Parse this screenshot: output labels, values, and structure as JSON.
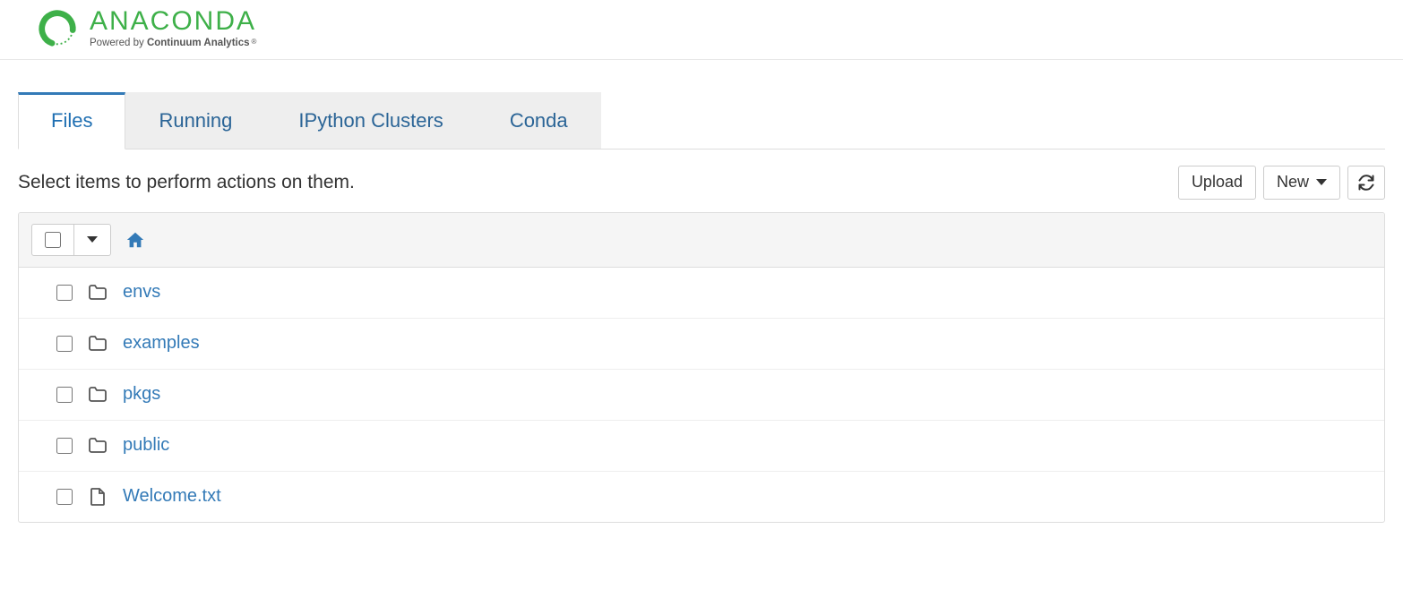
{
  "brand": {
    "name": "ANACONDA",
    "tagline_prefix": "Powered by ",
    "tagline_bold": "Continuum Analytics"
  },
  "tabs": [
    {
      "label": "Files",
      "active": true
    },
    {
      "label": "Running",
      "active": false
    },
    {
      "label": "IPython Clusters",
      "active": false
    },
    {
      "label": "Conda",
      "active": false
    }
  ],
  "instructions": "Select items to perform actions on them.",
  "buttons": {
    "upload": "Upload",
    "new": "New"
  },
  "items": [
    {
      "kind": "folder",
      "name": "envs"
    },
    {
      "kind": "folder",
      "name": "examples"
    },
    {
      "kind": "folder",
      "name": "pkgs"
    },
    {
      "kind": "folder",
      "name": "public"
    },
    {
      "kind": "file",
      "name": "Welcome.txt"
    }
  ]
}
